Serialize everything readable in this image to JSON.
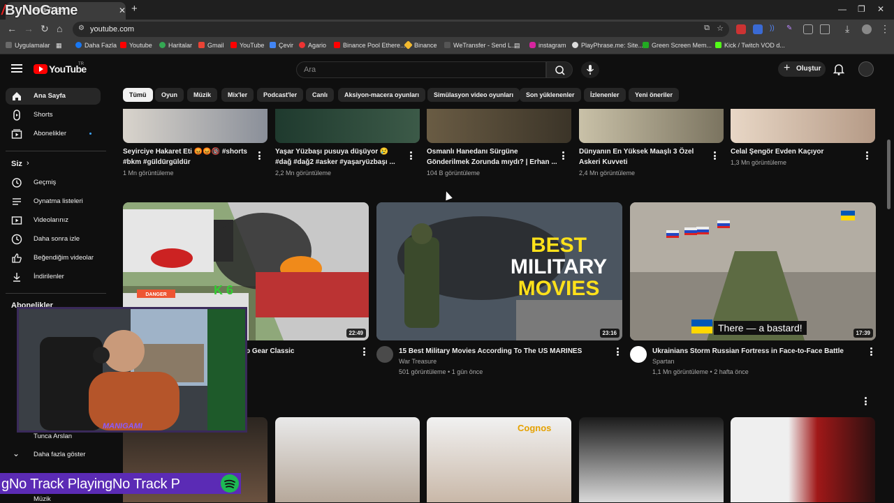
{
  "browser": {
    "brand": "ByNoGame",
    "tab_title": "Ana Tube",
    "url": "youtube.com",
    "bookmarks": [
      "Uygulamalar",
      "Daha Fazla",
      "Youtube",
      "Haritalar",
      "Gmail",
      "YouTube",
      "Çevir",
      "Agario",
      "Binance Pool Ethere...",
      "Binance",
      "WeTransfer - Send L...",
      "instagram",
      "PlayPhrase.me: Site...",
      "Green Screen Mem...",
      "Kick / Twitch VOD d..."
    ]
  },
  "masthead": {
    "logo_text": "YouTube",
    "logo_region": "TR",
    "search_placeholder": "Ara",
    "create_label": "Oluştur"
  },
  "sidebar": {
    "items": [
      {
        "label": "Ana Sayfa",
        "icon": "home-icon"
      },
      {
        "label": "Shorts",
        "icon": "shorts-icon"
      },
      {
        "label": "Abonelikler",
        "icon": "subscriptions-icon"
      }
    ],
    "you_header": "Siz",
    "you_items": [
      {
        "label": "Geçmiş",
        "icon": "history-icon"
      },
      {
        "label": "Oynatma listeleri",
        "icon": "playlist-icon"
      },
      {
        "label": "Videolarınız",
        "icon": "video-icon"
      },
      {
        "label": "Daha sonra izle",
        "icon": "clock-icon"
      },
      {
        "label": "Beğendiğim videolar",
        "icon": "like-icon"
      },
      {
        "label": "İndirilenler",
        "icon": "download-icon"
      }
    ],
    "subs_header": "Abonelikler",
    "channel_partial": "Tunca Arslan",
    "show_more": "Daha fazla göster",
    "music_partial": "Müzik"
  },
  "chips": [
    "Tümü",
    "Oyun",
    "Müzik",
    "Mix'ler",
    "Podcast'ler",
    "Canlı",
    "Aksiyon-macera oyunları",
    "Simülasyon video oyunları",
    "Son yüklenenler",
    "İzlenenler",
    "Yeni öneriler"
  ],
  "row1": [
    {
      "title": "Seyirciye Hakaret Eti 😡😡🔞 #shorts #bkm #güldürgüldür",
      "views": "1 Mn görüntüleme"
    },
    {
      "title": "Yaşar Yüzbaşı pusuya düşüyor 😢 #dağ #dağ2 #asker #yaşaryüzbaşı ...",
      "views": "2,2 Mn görüntüleme"
    },
    {
      "title": "Osmanlı Hanedanı Sürgüne Gönderilmek Zorunda mıydı? | Erhan ...",
      "views": "104 B görüntüleme"
    },
    {
      "title": "Dünyanın En Yüksek Maaşlı 3 Özel Askeri Kuvveti",
      "views": "2,4 Mn görüntüleme"
    },
    {
      "title": "Celal Şengör Evden Kaçıyor",
      "views": "1,3 Mn görüntüleme"
    }
  ],
  "row2": [
    {
      "title": "p Gear Classic",
      "channel": "",
      "meta": "",
      "duration": "22:49"
    },
    {
      "title": "15 Best Military Movies According To The US MARINES",
      "channel": "War Treasure",
      "meta": "501 görüntüleme • 1 gün önce",
      "duration": "23:16",
      "thumb_text": [
        "BEST",
        "MILITARY",
        "MOVIES"
      ]
    },
    {
      "title": "Ukrainians Storm Russian Fortress in Face-to-Face Battle",
      "channel": "Spartan",
      "meta": "1,1 Mn görüntüleme • 2 hafta önce",
      "duration": "17:39",
      "thumb_caption": "There — a bastard!"
    }
  ],
  "row3_thumb_text": "Cognos",
  "row2_first_overlay": "K 6",
  "row2_first_sign": "DANGER",
  "overlay": {
    "ticker": "gNo Track PlayingNo Track P",
    "webcam_tag": "MANIGAMI"
  }
}
